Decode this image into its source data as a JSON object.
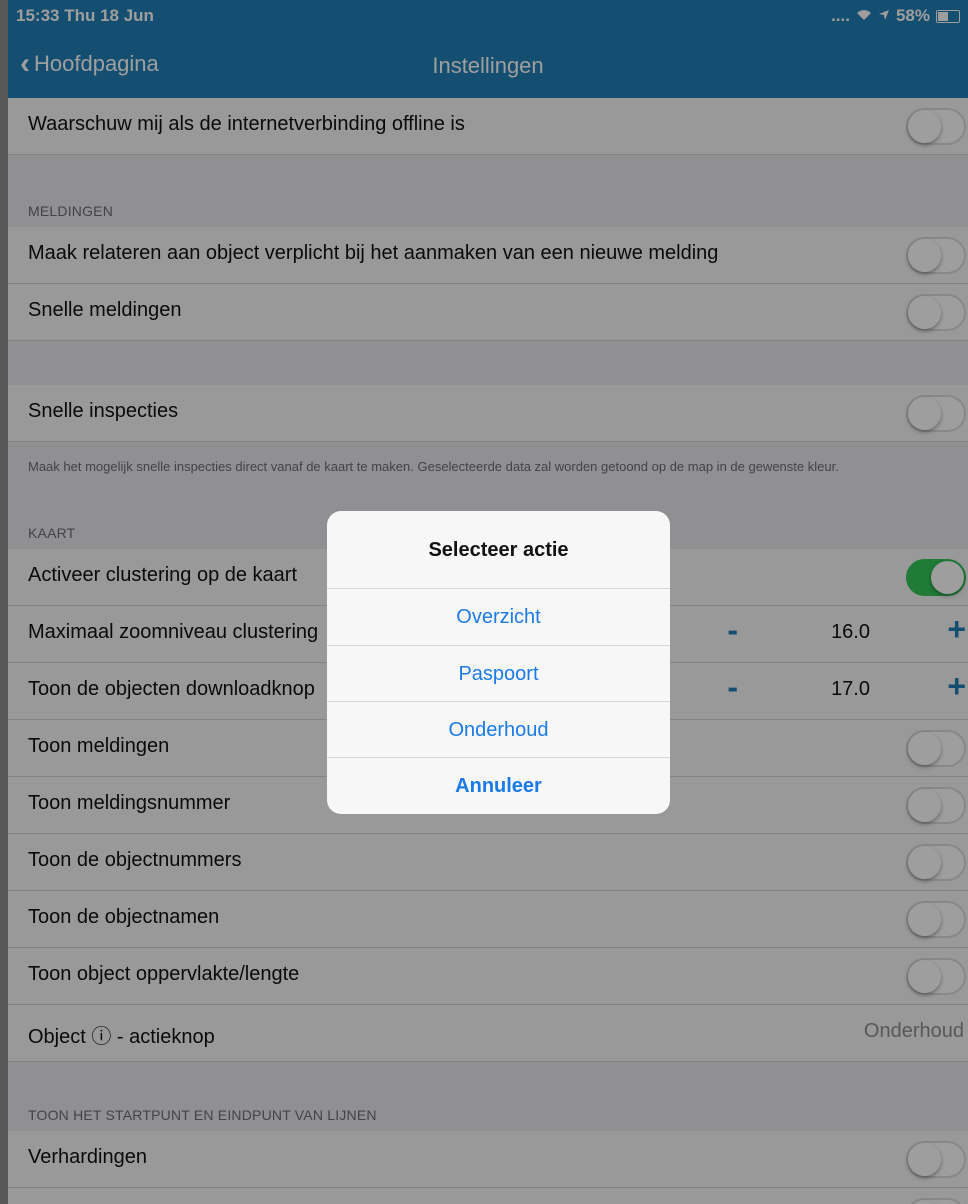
{
  "status_bar": {
    "time_date": "15:33  Thu 18 Jun",
    "signal": "....",
    "battery": "58%",
    "battery_level": 0.58
  },
  "nav": {
    "back_label": "Hoofdpagina",
    "title": "Instellingen"
  },
  "settings": {
    "offline_warning": {
      "label": "Waarschuw mij als de internetverbinding offline is",
      "on": false
    },
    "meldingen_header": "MELDINGEN",
    "relateren_verplicht": {
      "label": "Maak relateren aan object verplicht bij het aanmaken van een nieuwe melding",
      "on": false
    },
    "snelle_meldingen": {
      "label": "Snelle meldingen",
      "on": false
    },
    "snelle_inspecties": {
      "label": "Snelle inspecties",
      "on": false
    },
    "snelle_inspecties_footnote": "Maak het mogelijk snelle inspecties direct vanaf de kaart te maken. Geselecteerde data zal worden getoond op de map in de gewenste kleur.",
    "kaart_header": "KAART",
    "clustering": {
      "label": "Activeer clustering op de kaart",
      "on": true
    },
    "max_zoom_clustering": {
      "label": "Maximaal zoomniveau clustering",
      "minus": "-",
      "value": "16.0",
      "plus": "+"
    },
    "download_button": {
      "label": "Toon de objecten downloadknop",
      "minus": "-",
      "value": "17.0",
      "plus": "+"
    },
    "toon_meldingen": {
      "label": "Toon meldingen",
      "on": false
    },
    "toon_meldingsnummer": {
      "label": "Toon meldingsnummer",
      "on": false
    },
    "toon_objectnummers": {
      "label": "Toon de objectnummers",
      "on": false
    },
    "toon_objectnamen": {
      "label": "Toon de objectnamen",
      "on": false
    },
    "toon_oppervlakte": {
      "label": "Toon object oppervlakte/lengte",
      "on": false
    },
    "actieknop": {
      "label": "Object ⓘ - actieknop",
      "value": "Onderhoud"
    },
    "lijnen_header": "TOON HET STARTPUNT EN EINDPUNT VAN LIJNEN",
    "verhardingen": {
      "label": "Verhardingen",
      "on": false
    }
  },
  "dialog": {
    "title": "Selecteer actie",
    "actions": [
      "Overzicht",
      "Paspoort",
      "Onderhoud"
    ],
    "cancel": "Annuleer"
  },
  "colors": {
    "accent": "#217fb5",
    "toggle_on": "#34c759",
    "dialog_action": "#1a7ae8"
  }
}
